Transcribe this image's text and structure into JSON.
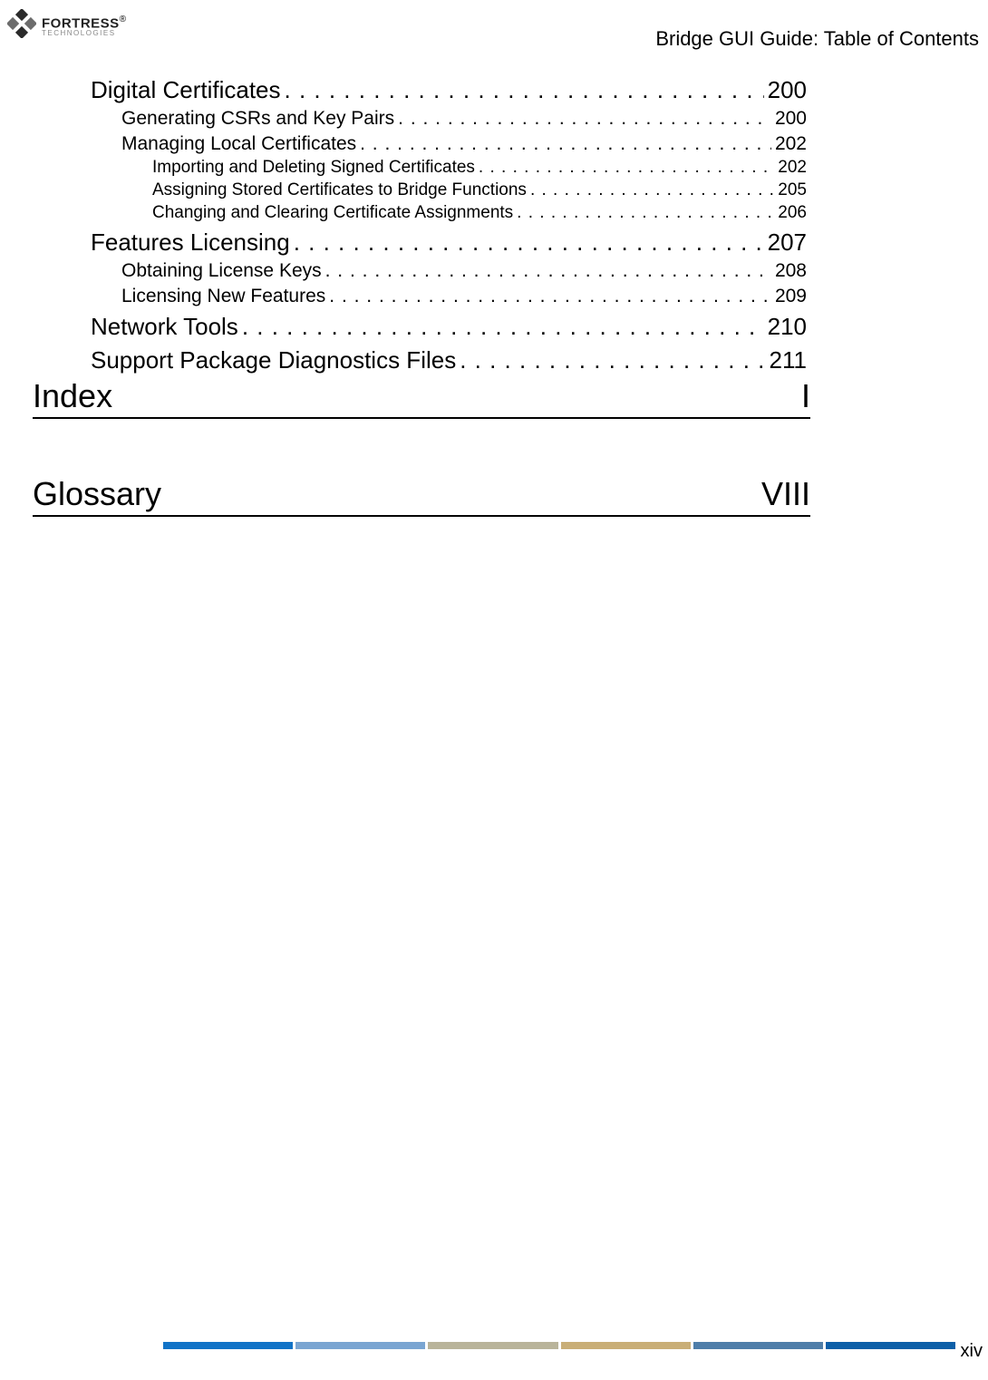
{
  "header": {
    "title": "Bridge GUI Guide: Table of Contents",
    "logo_main": "FORTRESS",
    "logo_reg": "®",
    "logo_sub": "TECHNOLOGIES"
  },
  "toc": [
    {
      "level": 1,
      "label": "Digital Certificates",
      "page": "200"
    },
    {
      "level": 2,
      "label": "Generating CSRs and Key Pairs",
      "page": "200"
    },
    {
      "level": 2,
      "label": "Managing Local Certificates",
      "page": "202"
    },
    {
      "level": 3,
      "label": "Importing and Deleting Signed Certificates",
      "page": "202"
    },
    {
      "level": 3,
      "label": "Assigning Stored Certificates to Bridge Functions",
      "page": "205"
    },
    {
      "level": 3,
      "label": "Changing and Clearing Certificate Assignments",
      "page": "206"
    },
    {
      "level": 1,
      "label": "Features Licensing",
      "page": "207"
    },
    {
      "level": 2,
      "label": "Obtaining License Keys",
      "page": "208"
    },
    {
      "level": 2,
      "label": "Licensing New Features",
      "page": "209"
    },
    {
      "level": 1,
      "label": "Network Tools",
      "page": "210"
    },
    {
      "level": 1,
      "label": "Support Package Diagnostics Files",
      "page": "211"
    }
  ],
  "sections": {
    "index": {
      "label": "Index",
      "page": "I"
    },
    "glossary": {
      "label": "Glossary",
      "page": "VIII"
    }
  },
  "footer": {
    "page_number": "xiv",
    "bar_colors": [
      "#1173c7",
      "#7aa5d2",
      "#b9b49a",
      "#c9ae77",
      "#4f7ea9",
      "#0c5fa8"
    ]
  }
}
